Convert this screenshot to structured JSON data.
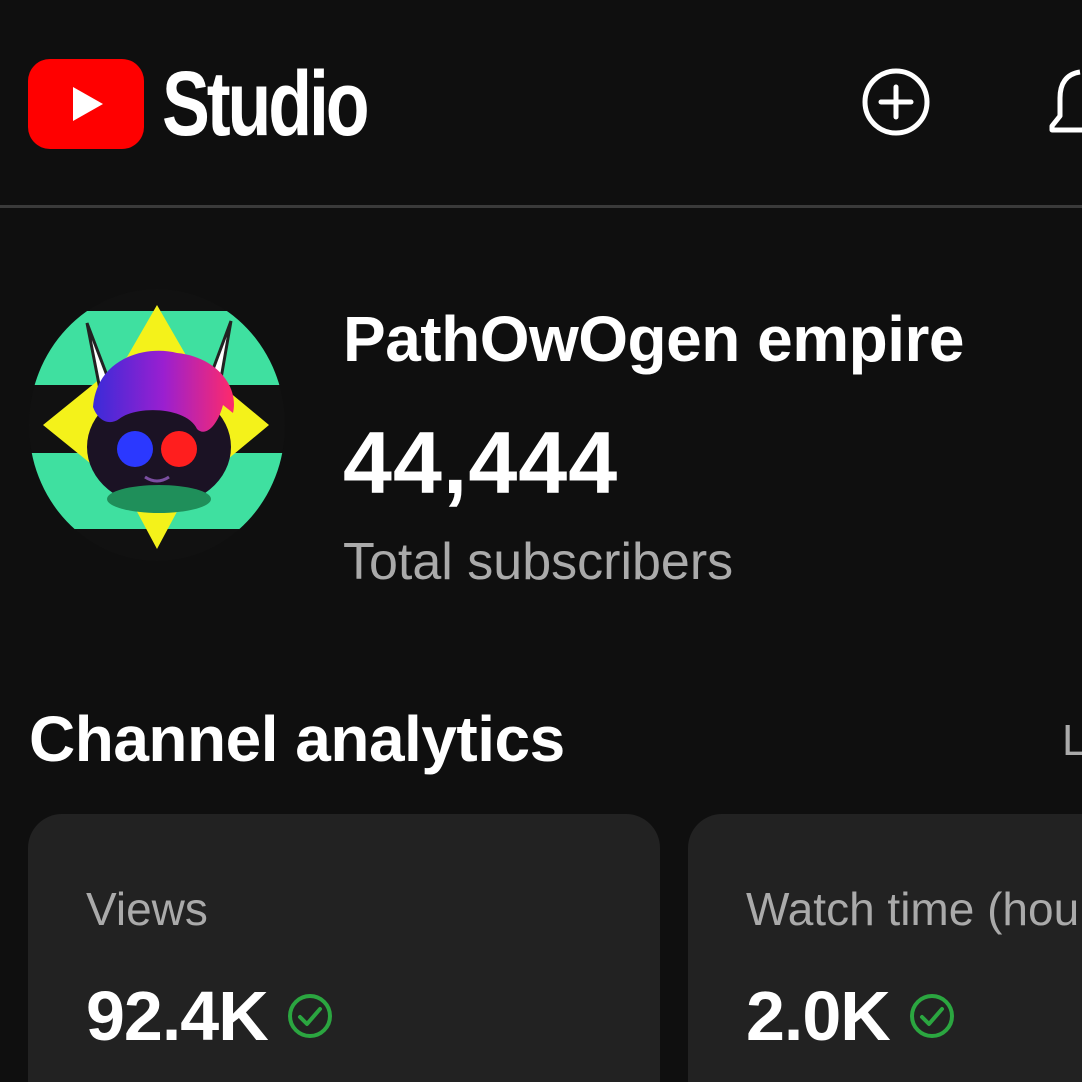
{
  "header": {
    "app_name": "Studio",
    "brand_color": "#ff0000",
    "icons": [
      "youtube-play-icon",
      "create-plus-icon",
      "notifications-bell-icon"
    ]
  },
  "channel": {
    "name": "PathOwOgen empire",
    "subscriber_count": "44,444",
    "subscriber_label": "Total subscribers"
  },
  "analytics": {
    "title": "Channel analytics",
    "link_label": "L",
    "cards": [
      {
        "label": "Views",
        "value": "92.4K",
        "status_icon": "check-circle-icon",
        "status_color": "#2ba640"
      },
      {
        "label": "Watch time (hour",
        "value": "2.0K",
        "status_icon": "check-circle-icon",
        "status_color": "#2ba640"
      }
    ]
  }
}
